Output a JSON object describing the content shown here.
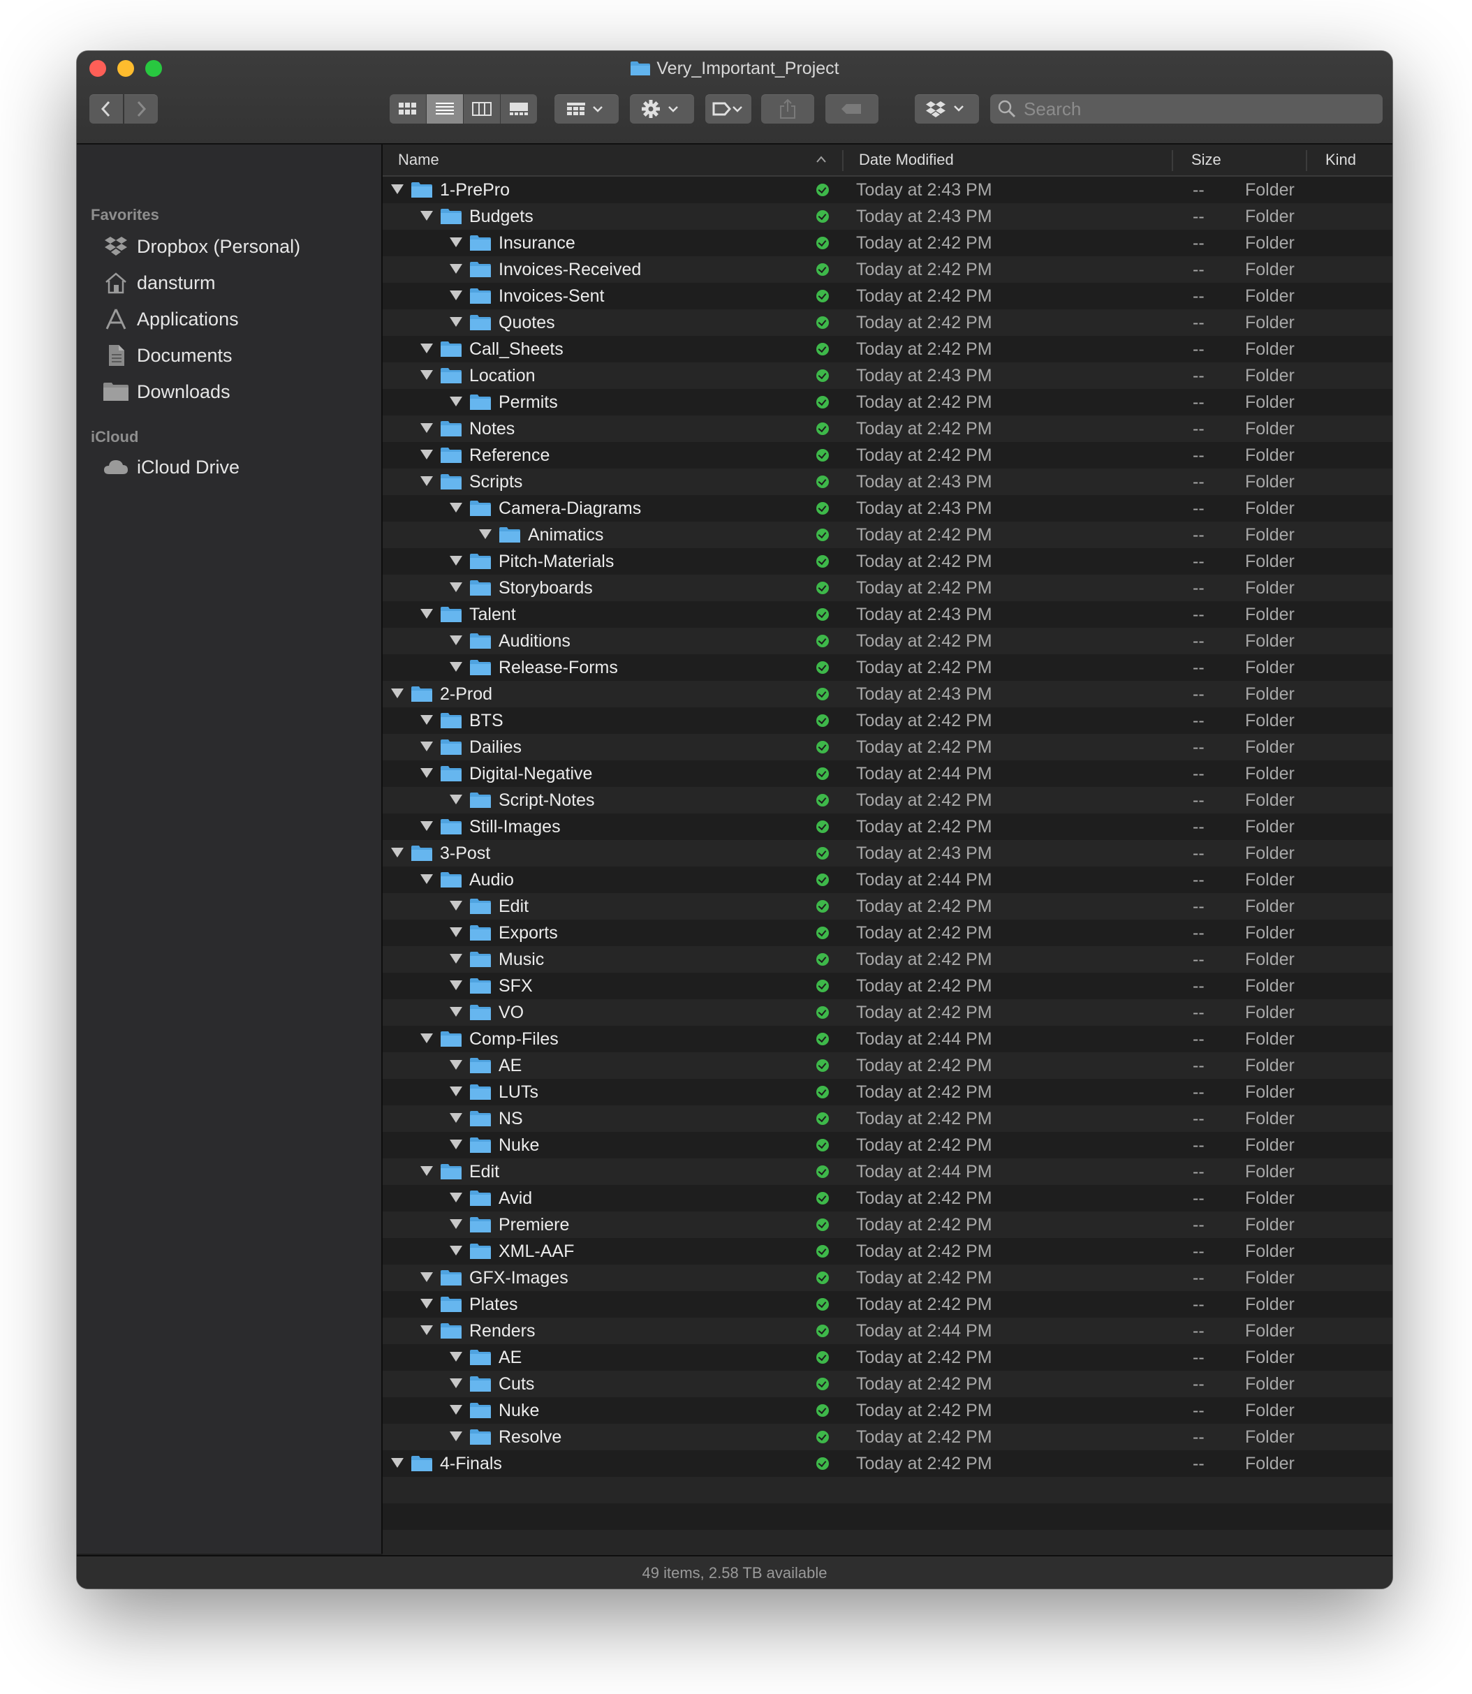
{
  "window": {
    "title": "Very_Important_Project",
    "status": "49 items, 2.58 TB available"
  },
  "toolbar": {
    "search_placeholder": "Search",
    "view_modes": [
      "icon-view",
      "list-view",
      "column-view",
      "gallery-view"
    ],
    "active_view": "list-view"
  },
  "sidebar": {
    "favorites_heading": "Favorites",
    "favorites": [
      {
        "label": "Dropbox (Personal)",
        "icon": "dropbox-icon"
      },
      {
        "label": "dansturm",
        "icon": "home-icon"
      },
      {
        "label": "Applications",
        "icon": "applications-icon"
      },
      {
        "label": "Documents",
        "icon": "documents-icon"
      },
      {
        "label": "Downloads",
        "icon": "downloads-folder-icon"
      }
    ],
    "icloud_heading": "iCloud",
    "icloud": [
      {
        "label": "iCloud Drive",
        "icon": "cloud-icon"
      }
    ]
  },
  "columns": {
    "name": "Name",
    "date": "Date Modified",
    "size": "Size",
    "kind": "Kind"
  },
  "rows": [
    {
      "name": "1-PrePro",
      "depth": 0,
      "date": "Today at 2:43 PM",
      "size": "--",
      "kind": "Folder"
    },
    {
      "name": "Budgets",
      "depth": 1,
      "date": "Today at 2:43 PM",
      "size": "--",
      "kind": "Folder"
    },
    {
      "name": "Insurance",
      "depth": 2,
      "date": "Today at 2:42 PM",
      "size": "--",
      "kind": "Folder"
    },
    {
      "name": "Invoices-Received",
      "depth": 2,
      "date": "Today at 2:42 PM",
      "size": "--",
      "kind": "Folder"
    },
    {
      "name": "Invoices-Sent",
      "depth": 2,
      "date": "Today at 2:42 PM",
      "size": "--",
      "kind": "Folder"
    },
    {
      "name": "Quotes",
      "depth": 2,
      "date": "Today at 2:42 PM",
      "size": "--",
      "kind": "Folder"
    },
    {
      "name": "Call_Sheets",
      "depth": 1,
      "date": "Today at 2:42 PM",
      "size": "--",
      "kind": "Folder"
    },
    {
      "name": "Location",
      "depth": 1,
      "date": "Today at 2:43 PM",
      "size": "--",
      "kind": "Folder"
    },
    {
      "name": "Permits",
      "depth": 2,
      "date": "Today at 2:42 PM",
      "size": "--",
      "kind": "Folder"
    },
    {
      "name": "Notes",
      "depth": 1,
      "date": "Today at 2:42 PM",
      "size": "--",
      "kind": "Folder"
    },
    {
      "name": "Reference",
      "depth": 1,
      "date": "Today at 2:42 PM",
      "size": "--",
      "kind": "Folder"
    },
    {
      "name": "Scripts",
      "depth": 1,
      "date": "Today at 2:43 PM",
      "size": "--",
      "kind": "Folder"
    },
    {
      "name": "Camera-Diagrams",
      "depth": 2,
      "date": "Today at 2:43 PM",
      "size": "--",
      "kind": "Folder"
    },
    {
      "name": "Animatics",
      "depth": 3,
      "date": "Today at 2:42 PM",
      "size": "--",
      "kind": "Folder"
    },
    {
      "name": "Pitch-Materials",
      "depth": 2,
      "date": "Today at 2:42 PM",
      "size": "--",
      "kind": "Folder"
    },
    {
      "name": "Storyboards",
      "depth": 2,
      "date": "Today at 2:42 PM",
      "size": "--",
      "kind": "Folder"
    },
    {
      "name": "Talent",
      "depth": 1,
      "date": "Today at 2:43 PM",
      "size": "--",
      "kind": "Folder"
    },
    {
      "name": "Auditions",
      "depth": 2,
      "date": "Today at 2:42 PM",
      "size": "--",
      "kind": "Folder"
    },
    {
      "name": "Release-Forms",
      "depth": 2,
      "date": "Today at 2:42 PM",
      "size": "--",
      "kind": "Folder"
    },
    {
      "name": "2-Prod",
      "depth": 0,
      "date": "Today at 2:43 PM",
      "size": "--",
      "kind": "Folder"
    },
    {
      "name": "BTS",
      "depth": 1,
      "date": "Today at 2:42 PM",
      "size": "--",
      "kind": "Folder"
    },
    {
      "name": "Dailies",
      "depth": 1,
      "date": "Today at 2:42 PM",
      "size": "--",
      "kind": "Folder"
    },
    {
      "name": "Digital-Negative",
      "depth": 1,
      "date": "Today at 2:44 PM",
      "size": "--",
      "kind": "Folder"
    },
    {
      "name": "Script-Notes",
      "depth": 2,
      "date": "Today at 2:42 PM",
      "size": "--",
      "kind": "Folder"
    },
    {
      "name": "Still-Images",
      "depth": 1,
      "date": "Today at 2:42 PM",
      "size": "--",
      "kind": "Folder"
    },
    {
      "name": "3-Post",
      "depth": 0,
      "date": "Today at 2:43 PM",
      "size": "--",
      "kind": "Folder"
    },
    {
      "name": "Audio",
      "depth": 1,
      "date": "Today at 2:44 PM",
      "size": "--",
      "kind": "Folder"
    },
    {
      "name": "Edit",
      "depth": 2,
      "date": "Today at 2:42 PM",
      "size": "--",
      "kind": "Folder"
    },
    {
      "name": "Exports",
      "depth": 2,
      "date": "Today at 2:42 PM",
      "size": "--",
      "kind": "Folder"
    },
    {
      "name": "Music",
      "depth": 2,
      "date": "Today at 2:42 PM",
      "size": "--",
      "kind": "Folder"
    },
    {
      "name": "SFX",
      "depth": 2,
      "date": "Today at 2:42 PM",
      "size": "--",
      "kind": "Folder"
    },
    {
      "name": "VO",
      "depth": 2,
      "date": "Today at 2:42 PM",
      "size": "--",
      "kind": "Folder"
    },
    {
      "name": "Comp-Files",
      "depth": 1,
      "date": "Today at 2:44 PM",
      "size": "--",
      "kind": "Folder"
    },
    {
      "name": "AE",
      "depth": 2,
      "date": "Today at 2:42 PM",
      "size": "--",
      "kind": "Folder"
    },
    {
      "name": "LUTs",
      "depth": 2,
      "date": "Today at 2:42 PM",
      "size": "--",
      "kind": "Folder"
    },
    {
      "name": "NS",
      "depth": 2,
      "date": "Today at 2:42 PM",
      "size": "--",
      "kind": "Folder"
    },
    {
      "name": "Nuke",
      "depth": 2,
      "date": "Today at 2:42 PM",
      "size": "--",
      "kind": "Folder"
    },
    {
      "name": "Edit",
      "depth": 1,
      "date": "Today at 2:44 PM",
      "size": "--",
      "kind": "Folder"
    },
    {
      "name": "Avid",
      "depth": 2,
      "date": "Today at 2:42 PM",
      "size": "--",
      "kind": "Folder"
    },
    {
      "name": "Premiere",
      "depth": 2,
      "date": "Today at 2:42 PM",
      "size": "--",
      "kind": "Folder"
    },
    {
      "name": "XML-AAF",
      "depth": 2,
      "date": "Today at 2:42 PM",
      "size": "--",
      "kind": "Folder"
    },
    {
      "name": "GFX-Images",
      "depth": 1,
      "date": "Today at 2:42 PM",
      "size": "--",
      "kind": "Folder"
    },
    {
      "name": "Plates",
      "depth": 1,
      "date": "Today at 2:42 PM",
      "size": "--",
      "kind": "Folder"
    },
    {
      "name": "Renders",
      "depth": 1,
      "date": "Today at 2:44 PM",
      "size": "--",
      "kind": "Folder"
    },
    {
      "name": "AE",
      "depth": 2,
      "date": "Today at 2:42 PM",
      "size": "--",
      "kind": "Folder"
    },
    {
      "name": "Cuts",
      "depth": 2,
      "date": "Today at 2:42 PM",
      "size": "--",
      "kind": "Folder"
    },
    {
      "name": "Nuke",
      "depth": 2,
      "date": "Today at 2:42 PM",
      "size": "--",
      "kind": "Folder"
    },
    {
      "name": "Resolve",
      "depth": 2,
      "date": "Today at 2:42 PM",
      "size": "--",
      "kind": "Folder"
    },
    {
      "name": "4-Finals",
      "depth": 0,
      "date": "Today at 2:42 PM",
      "size": "--",
      "kind": "Folder"
    }
  ],
  "colors": {
    "folder_blue": "#4fa3e0",
    "sync_green": "#3eb84a",
    "row_alt": "#262626",
    "window_bg": "#1e1e1e"
  }
}
